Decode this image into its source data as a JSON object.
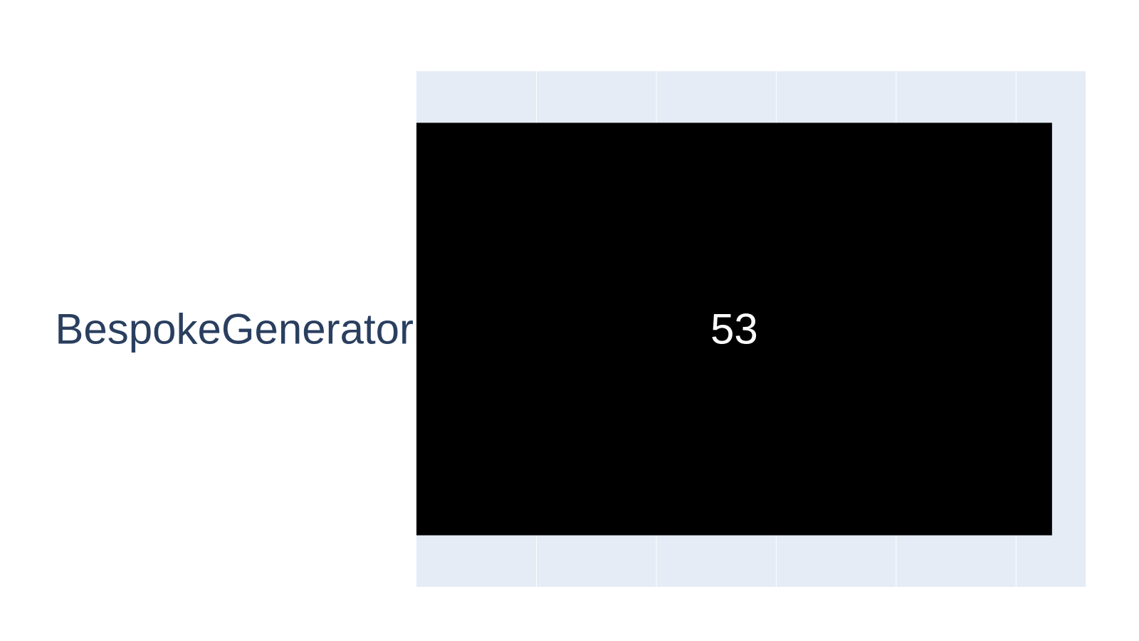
{
  "chart_data": {
    "type": "bar",
    "orientation": "horizontal",
    "categories": [
      "BespokeGenerator"
    ],
    "values": [
      53
    ],
    "data_labels": [
      "53"
    ],
    "xlim": [
      0,
      55.8
    ],
    "x_gridlines": [
      10,
      20,
      30,
      40,
      50
    ],
    "grid": true,
    "show_x_tick_labels": false,
    "title": "",
    "xlabel": "",
    "ylabel": "",
    "colors": {
      "bar": "#000000",
      "plot_background": "#e5ecf6",
      "gridline": "#ffffff",
      "tick_label": "#2a3f5f",
      "data_label": "#ffffff",
      "page_background": "#ffffff"
    }
  }
}
